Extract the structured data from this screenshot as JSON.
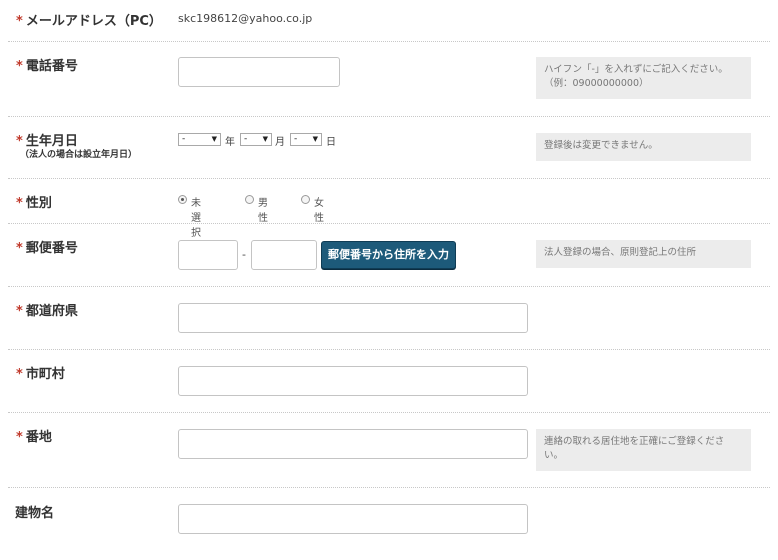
{
  "email": {
    "label": "メールアドレス（PC）",
    "value": "skc198612@yahoo.co.jp"
  },
  "phone": {
    "label": "電話番号",
    "note_line1": "ハイフン「-」を入れずにご記入ください。",
    "note_line2": "（例：09000000000）"
  },
  "birthday": {
    "label": "生年月日",
    "sublabel": "（法人の場合は設立年月日）",
    "year_value": "-",
    "month_value": "-",
    "day_value": "-",
    "year_unit": "年",
    "month_unit": "月",
    "day_unit": "日",
    "note": "登録後は変更できません。"
  },
  "gender": {
    "label": "性別",
    "options": [
      "未選択",
      "男性",
      "女性"
    ],
    "selected": "未選択"
  },
  "postal": {
    "label": "郵便番号",
    "separator": "-",
    "button_label": "郵便番号から住所を入力",
    "note": "法人登録の場合、原則登記上の住所"
  },
  "prefecture": {
    "label": "都道府県"
  },
  "city": {
    "label": "市町村"
  },
  "address": {
    "label": "番地",
    "note_line1": "連絡の取れる居住地を正確にご登録くださ",
    "note_line2": "い。"
  },
  "building": {
    "label": "建物名"
  },
  "required_mark": "*"
}
